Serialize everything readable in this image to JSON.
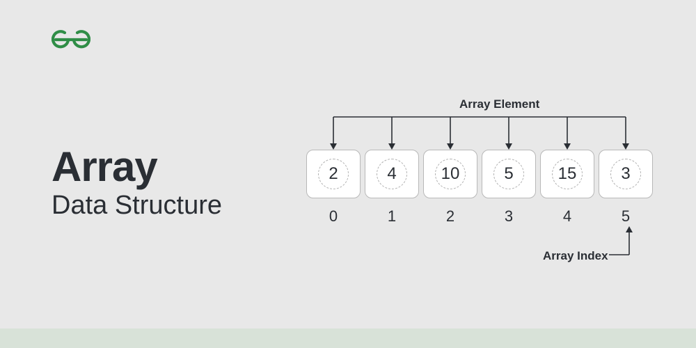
{
  "logo": {
    "name": "geeksforgeeks-logo",
    "color": "#2f8d46"
  },
  "title": {
    "main": "Array",
    "sub": "Data Structure"
  },
  "labels": {
    "element": "Array Element",
    "index": "Array Index"
  },
  "array": {
    "values": [
      2,
      4,
      10,
      5,
      15,
      3
    ],
    "indices": [
      0,
      1,
      2,
      3,
      4,
      5
    ]
  },
  "colors": {
    "dark": "#2a2e34",
    "bg": "#e8e8e8",
    "cell": "#ffffff",
    "accent_bar": "#d8e2d8"
  }
}
